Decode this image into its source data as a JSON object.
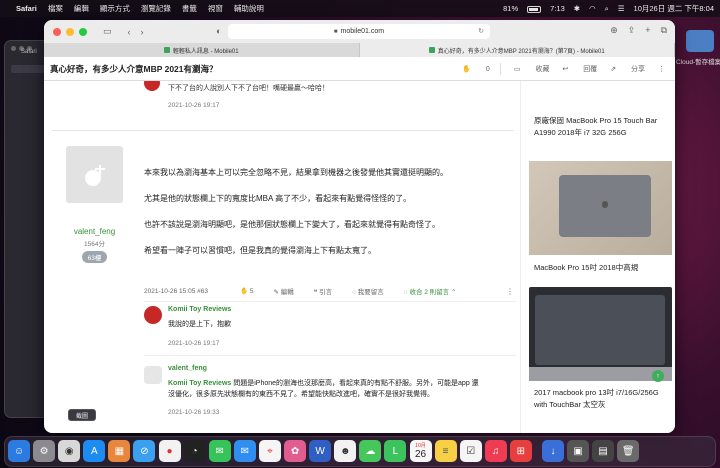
{
  "menubar": {
    "app": "Safari",
    "items": [
      "檔案",
      "編輯",
      "顯示方式",
      "瀏覽記錄",
      "書籤",
      "視窗",
      "輔助說明"
    ],
    "battery": "81%",
    "time": "7:13",
    "datetime": "10月26日 週二 下午8:04"
  },
  "bgwindow": {
    "title": "Safari"
  },
  "browser": {
    "url": "mobile01.com",
    "tabs": [
      {
        "label": "輕輕私人訊息 - Mobile01",
        "active": false
      },
      {
        "label": "真心好奇，有多少人介意MBP 2021有瀏海？(第7頁) - Mobile01",
        "active": true
      }
    ]
  },
  "thread": {
    "title": "真心好奇，有多少人介意MBP 2021有瀏海？",
    "like_count": "0",
    "actions": {
      "bookmark": "收藏",
      "reply": "回覆",
      "share": "分享"
    }
  },
  "prev_reply": {
    "text": "下不了台的人說別人下不了台吧！嘴硬最贏～哈哈！",
    "date": "2021-10-26 19:17"
  },
  "post": {
    "username": "valent_feng",
    "user_count": "1564分",
    "floor": "63樓",
    "paragraphs": [
      "本來我以為瀏海基本上可以完全忽略不見，結果拿到機器之後發覺他其實還挺明顯的。",
      "尤其是他的狀態欄上下的寬度比MBA 高了不少，看起來有點覺得怪怪的了。",
      "也許不該說是瀏海明顯吧，是他那個狀態欄上下變大了，看起來就覺得有點奇怪了。",
      "希望看一陣子可以習慣吧，但是我真的覺得瀏海上下有點太寬了。"
    ],
    "meta": {
      "date": "2021-10-26 15:05 #63",
      "likes": "5",
      "edit": "編輯",
      "quote": "引言",
      "comment": "我要留言",
      "hide_comments": "收合 2 則留言"
    }
  },
  "comments": [
    {
      "name": "Komii Toy Reviews",
      "text": "我說的是上下，抱歉",
      "date": "2021-10-26 19:17"
    },
    {
      "name": "valent_feng",
      "quote_name": "Komii Toy Reviews",
      "text_line1": "問題是iPhone的瀏海也沒那麼高，看起來真的有點不舒服。另外，可能是app 還",
      "text_line2": "沒優化，很多原先狀態欄有的東西不見了。希望能快點改進吧，確實不是很好我覺得。",
      "date": "2021-10-26 19:33"
    }
  ],
  "sidebar": {
    "items": [
      {
        "text": "原廠保固 MacBook Pro 15 Touch Bar A1990 2018年 i7 32G 256G"
      },
      {
        "text": "MacBook Pro 15吋 2018中高規"
      },
      {
        "text": "2017 macbook pro 13吋 i7/16G/256G with TouchBar 太空灰"
      }
    ]
  },
  "tooltip": "截圖",
  "right_label": "Cloud-暫存檔案",
  "dock": {
    "calendar_month": "10月",
    "calendar_day": "26"
  }
}
